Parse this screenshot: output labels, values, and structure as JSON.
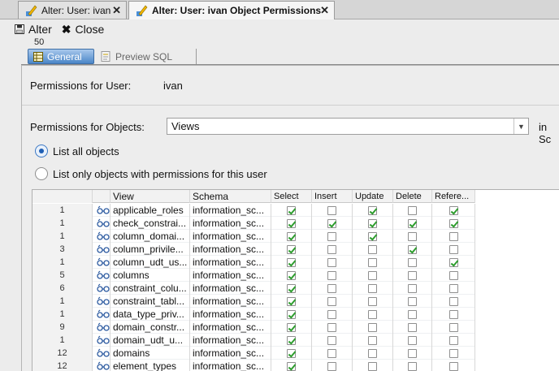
{
  "doc_tabs": [
    {
      "label": "Alter: User: ivan"
    },
    {
      "label": "Alter: User: ivan Object Permissions"
    }
  ],
  "toolbar": {
    "alter_label": "Alter",
    "close_label": "Close"
  },
  "badge_number": "50",
  "inner_tabs": [
    {
      "label": "General"
    },
    {
      "label": "Preview SQL"
    }
  ],
  "form": {
    "user_label": "Permissions for User:",
    "user_value": "ivan",
    "objects_label": "Permissions for Objects:",
    "objects_value": "Views",
    "schema_label_partial": "in Sc",
    "radio_all": "List all objects",
    "radio_only": "List only objects with permissions for this user"
  },
  "table": {
    "columns": [
      "View",
      "Schema",
      "Select",
      "Insert",
      "Update",
      "Delete",
      "Refere..."
    ],
    "rows": [
      {
        "num": "1",
        "view": "applicable_roles",
        "schema": "information_sc...",
        "select": true,
        "insert": false,
        "update": true,
        "delete": false,
        "references": true
      },
      {
        "num": "1",
        "view": "check_constrai...",
        "schema": "information_sc...",
        "select": true,
        "insert": true,
        "update": true,
        "delete": true,
        "references": true
      },
      {
        "num": "1",
        "view": "column_domai...",
        "schema": "information_sc...",
        "select": true,
        "insert": false,
        "update": true,
        "delete": false,
        "references": false
      },
      {
        "num": "3",
        "view": "column_privile...",
        "schema": "information_sc...",
        "select": true,
        "insert": false,
        "update": false,
        "delete": true,
        "references": false
      },
      {
        "num": "1",
        "view": "column_udt_us...",
        "schema": "information_sc...",
        "select": true,
        "insert": false,
        "update": false,
        "delete": false,
        "references": true
      },
      {
        "num": "5",
        "view": "columns",
        "schema": "information_sc...",
        "select": true,
        "insert": false,
        "update": false,
        "delete": false,
        "references": false
      },
      {
        "num": "6",
        "view": "constraint_colu...",
        "schema": "information_sc...",
        "select": true,
        "insert": false,
        "update": false,
        "delete": false,
        "references": false
      },
      {
        "num": "1",
        "view": "constraint_tabl...",
        "schema": "information_sc...",
        "select": true,
        "insert": false,
        "update": false,
        "delete": false,
        "references": false
      },
      {
        "num": "1",
        "view": "data_type_priv...",
        "schema": "information_sc...",
        "select": true,
        "insert": false,
        "update": false,
        "delete": false,
        "references": false
      },
      {
        "num": "9",
        "view": "domain_constr...",
        "schema": "information_sc...",
        "select": true,
        "insert": false,
        "update": false,
        "delete": false,
        "references": false
      },
      {
        "num": "1",
        "view": "domain_udt_u...",
        "schema": "information_sc...",
        "select": true,
        "insert": false,
        "update": false,
        "delete": false,
        "references": false
      },
      {
        "num": "12",
        "view": "domains",
        "schema": "information_sc...",
        "select": true,
        "insert": false,
        "update": false,
        "delete": false,
        "references": false
      },
      {
        "num": "12",
        "view": "element_types",
        "schema": "information_sc...",
        "select": true,
        "insert": false,
        "update": false,
        "delete": false,
        "references": false
      }
    ]
  }
}
